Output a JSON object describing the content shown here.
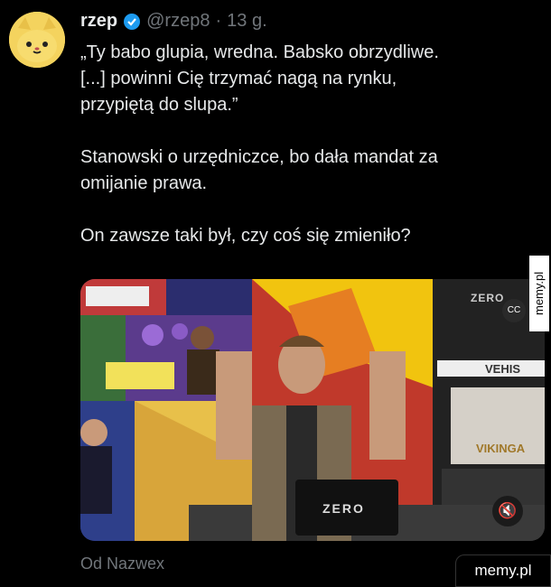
{
  "tweet": {
    "display_name": "rzep",
    "handle": "@rzep8",
    "separator": "·",
    "time": "13 g.",
    "lines": [
      "„Ty babo glupia, wredna. Babsko obrzydliwe.",
      "[...] powinni Cię trzymać nagą na rynku,",
      "przypiętą do slupa.”",
      "",
      "Stanowski o urzędniczce, bo dała mandat za",
      "omijanie prawa.",
      "",
      "On zawsze taki był, czy coś się zmieniło?"
    ],
    "source": "Od Nazwex"
  },
  "video": {
    "brand": "ZERO",
    "sponsor": "VEHIS",
    "viking_sign": "VIKINGA",
    "laptop_label": "ZERO",
    "cc_label": "CC",
    "mute_icon": "🔇"
  },
  "watermarks": {
    "side": "memy.pl",
    "bottom": "memy.pl"
  },
  "colors": {
    "bg": "#000000",
    "text": "#e7e9ea",
    "muted": "#71767b",
    "verified": "#1d9bf0",
    "avatar": "#f4d35e"
  }
}
